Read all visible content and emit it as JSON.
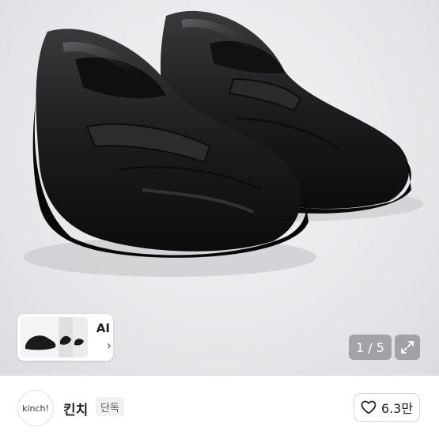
{
  "gallery": {
    "image": "black-penny-loafers-photo",
    "counter": "1 / 5",
    "expand_icon": "expand-icon",
    "ai_card": {
      "label": "AI",
      "chevron": "›"
    }
  },
  "seller": {
    "avatar_text": "kinch!",
    "name": "킨치",
    "badge": "단독"
  },
  "like": {
    "icon": "heart-icon",
    "count": "6.3만"
  },
  "colors": {
    "photo_bg": "#e9e9ec",
    "overlay": "#96969b",
    "badge_bg": "#f1f1f3"
  }
}
